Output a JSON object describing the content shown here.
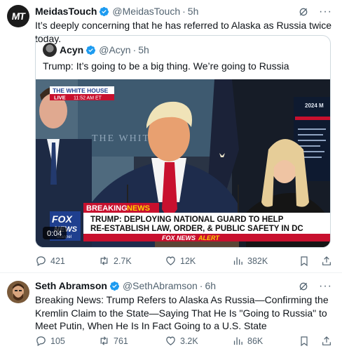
{
  "tweet1": {
    "author_name": "MeidasTouch",
    "handle": "@MeidasTouch",
    "time": "5h",
    "avatar_text": "MT",
    "text": "It’s deeply concerning that he has referred to Alaska as Russia twice today.",
    "quote": {
      "author_name": "Acyn",
      "handle": "@Acyn",
      "time": "5h",
      "text": "Trump: It’s going to be a big thing. We’re going to Russia",
      "video": {
        "duration": "0:04",
        "location_badge": "THE WHITE HOUSE",
        "live_text": "LIVE",
        "live_time": "11:52 AM ET",
        "breaking_label_1": "BREAKING",
        "breaking_label_2": "NEWS",
        "headline_line1": "TRUMP: DEPLOYING NATIONAL GUARD TO HELP",
        "headline_line2": "RE-ESTABLISH LAW, ORDER, & PUBLIC SAFETY IN DC",
        "alert_text_1": "FOX NEWS",
        "alert_text_2": "ALERT",
        "fox_logo_1": "FOX",
        "fox_logo_2": "NEWS",
        "fox_logo_3": "channel",
        "screen_text": "2024 M",
        "wall_text": "THE WHITE"
      }
    },
    "stats": {
      "replies": "421",
      "reposts": "2.7K",
      "likes": "12K",
      "views": "382K"
    }
  },
  "tweet2": {
    "author_name": "Seth Abramson",
    "handle": "@SethAbramson",
    "time": "6h",
    "text": "Breaking News: Trump Refers to Alaska As Russia—Confirming the Kremlin Claim to the State—Saying That He Is \"Going to Russia\" to Meet Putin, When He Is In Fact Going to a U.S. State",
    "stats": {
      "replies": "105",
      "reposts": "761",
      "likes": "3.2K",
      "views": "86K"
    }
  },
  "colors": {
    "verified": "#1d9bf0",
    "muted": "#536471",
    "border": "#cfd9de",
    "breaking_red": "#c8102e",
    "fox_blue": "#1f3f8f"
  }
}
